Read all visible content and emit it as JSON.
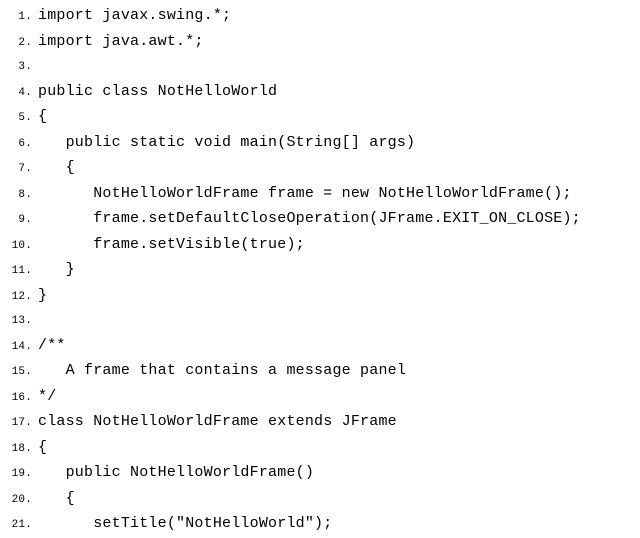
{
  "code": {
    "lines": [
      {
        "n": "1.",
        "t": "import javax.swing.*;"
      },
      {
        "n": "2.",
        "t": "import java.awt.*;"
      },
      {
        "n": "3.",
        "t": ""
      },
      {
        "n": "4.",
        "t": "public class NotHelloWorld"
      },
      {
        "n": "5.",
        "t": "{"
      },
      {
        "n": "6.",
        "t": "   public static void main(String[] args)"
      },
      {
        "n": "7.",
        "t": "   {"
      },
      {
        "n": "8.",
        "t": "      NotHelloWorldFrame frame = new NotHelloWorldFrame();"
      },
      {
        "n": "9.",
        "t": "      frame.setDefaultCloseOperation(JFrame.EXIT_ON_CLOSE);"
      },
      {
        "n": "10.",
        "t": "      frame.setVisible(true);"
      },
      {
        "n": "11.",
        "t": "   }"
      },
      {
        "n": "12.",
        "t": "}"
      },
      {
        "n": "13.",
        "t": ""
      },
      {
        "n": "14.",
        "t": "/**"
      },
      {
        "n": "15.",
        "t": "   A frame that contains a message panel"
      },
      {
        "n": "16.",
        "t": "*/"
      },
      {
        "n": "17.",
        "t": "class NotHelloWorldFrame extends JFrame"
      },
      {
        "n": "18.",
        "t": "{"
      },
      {
        "n": "19.",
        "t": "   public NotHelloWorldFrame()"
      },
      {
        "n": "20.",
        "t": "   {"
      },
      {
        "n": "21.",
        "t": "      setTitle(\"NotHelloWorld\");"
      }
    ]
  }
}
